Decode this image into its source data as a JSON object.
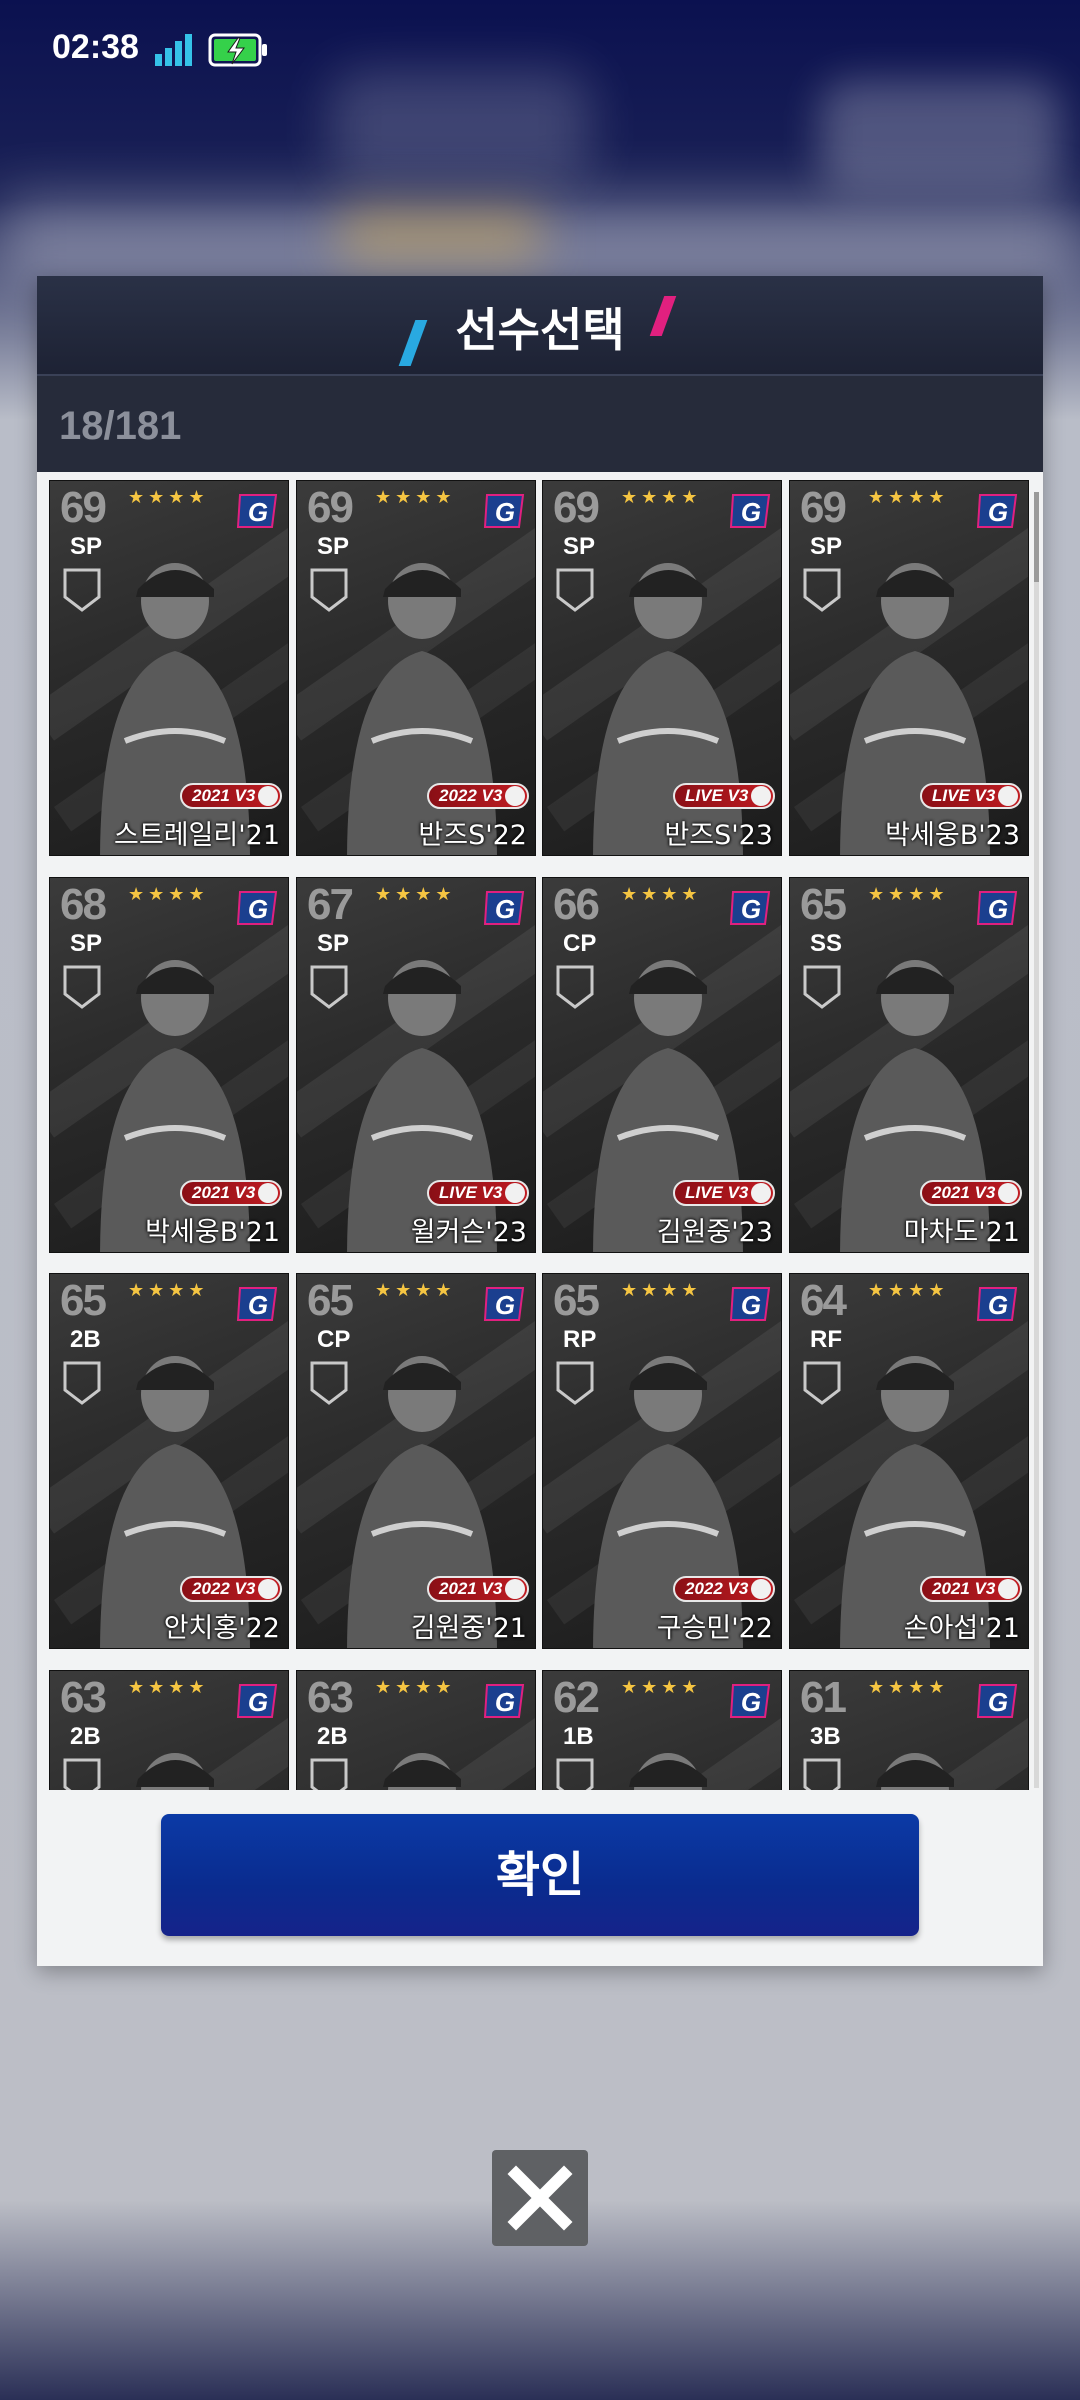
{
  "status_bar": {
    "time": "02:38"
  },
  "dialog": {
    "title": "선수선택",
    "count": "18/181",
    "confirm_label": "확인"
  },
  "cards": [
    {
      "rating": "69",
      "position": "SP",
      "badge": "2021 V3",
      "name": "스트레일리'21",
      "stars": "★★★★"
    },
    {
      "rating": "69",
      "position": "SP",
      "badge": "2022 V3",
      "name": "반즈S'22",
      "stars": "★★★★"
    },
    {
      "rating": "69",
      "position": "SP",
      "badge": "LIVE V3",
      "name": "반즈S'23",
      "stars": "★★★★"
    },
    {
      "rating": "69",
      "position": "SP",
      "badge": "LIVE V3",
      "name": "박세웅B'23",
      "stars": "★★★★"
    },
    {
      "rating": "68",
      "position": "SP",
      "badge": "2021 V3",
      "name": "박세웅B'21",
      "stars": "★★★★"
    },
    {
      "rating": "67",
      "position": "SP",
      "badge": "LIVE V3",
      "name": "윌커슨'23",
      "stars": "★★★★"
    },
    {
      "rating": "66",
      "position": "CP",
      "badge": "LIVE V3",
      "name": "김원중'23",
      "stars": "★★★★"
    },
    {
      "rating": "65",
      "position": "SS",
      "badge": "2021 V3",
      "name": "마차도'21",
      "stars": "★★★★"
    },
    {
      "rating": "65",
      "position": "2B",
      "badge": "2022 V3",
      "name": "안치홍'22",
      "stars": "★★★★"
    },
    {
      "rating": "65",
      "position": "CP",
      "badge": "2021 V3",
      "name": "김원중'21",
      "stars": "★★★★"
    },
    {
      "rating": "65",
      "position": "RP",
      "badge": "2022 V3",
      "name": "구승민'22",
      "stars": "★★★★"
    },
    {
      "rating": "64",
      "position": "RF",
      "badge": "2021 V3",
      "name": "손아섭'21",
      "stars": "★★★★"
    },
    {
      "rating": "63",
      "position": "2B",
      "badge": "",
      "name": "",
      "stars": "★★★★"
    },
    {
      "rating": "63",
      "position": "2B",
      "badge": "",
      "name": "",
      "stars": "★★★★"
    },
    {
      "rating": "62",
      "position": "1B",
      "badge": "",
      "name": "",
      "stars": "★★★★"
    },
    {
      "rating": "61",
      "position": "3B",
      "badge": "",
      "name": "",
      "stars": "★★★★"
    }
  ],
  "icons": {
    "signal": "signal-icon",
    "battery": "battery-charging-icon",
    "team_logo": "giants-logo-icon",
    "close": "close-icon"
  },
  "colors": {
    "accent_blue": "#29a9e1",
    "accent_pink": "#e1207f",
    "confirm_button": "#0b3aa6"
  }
}
